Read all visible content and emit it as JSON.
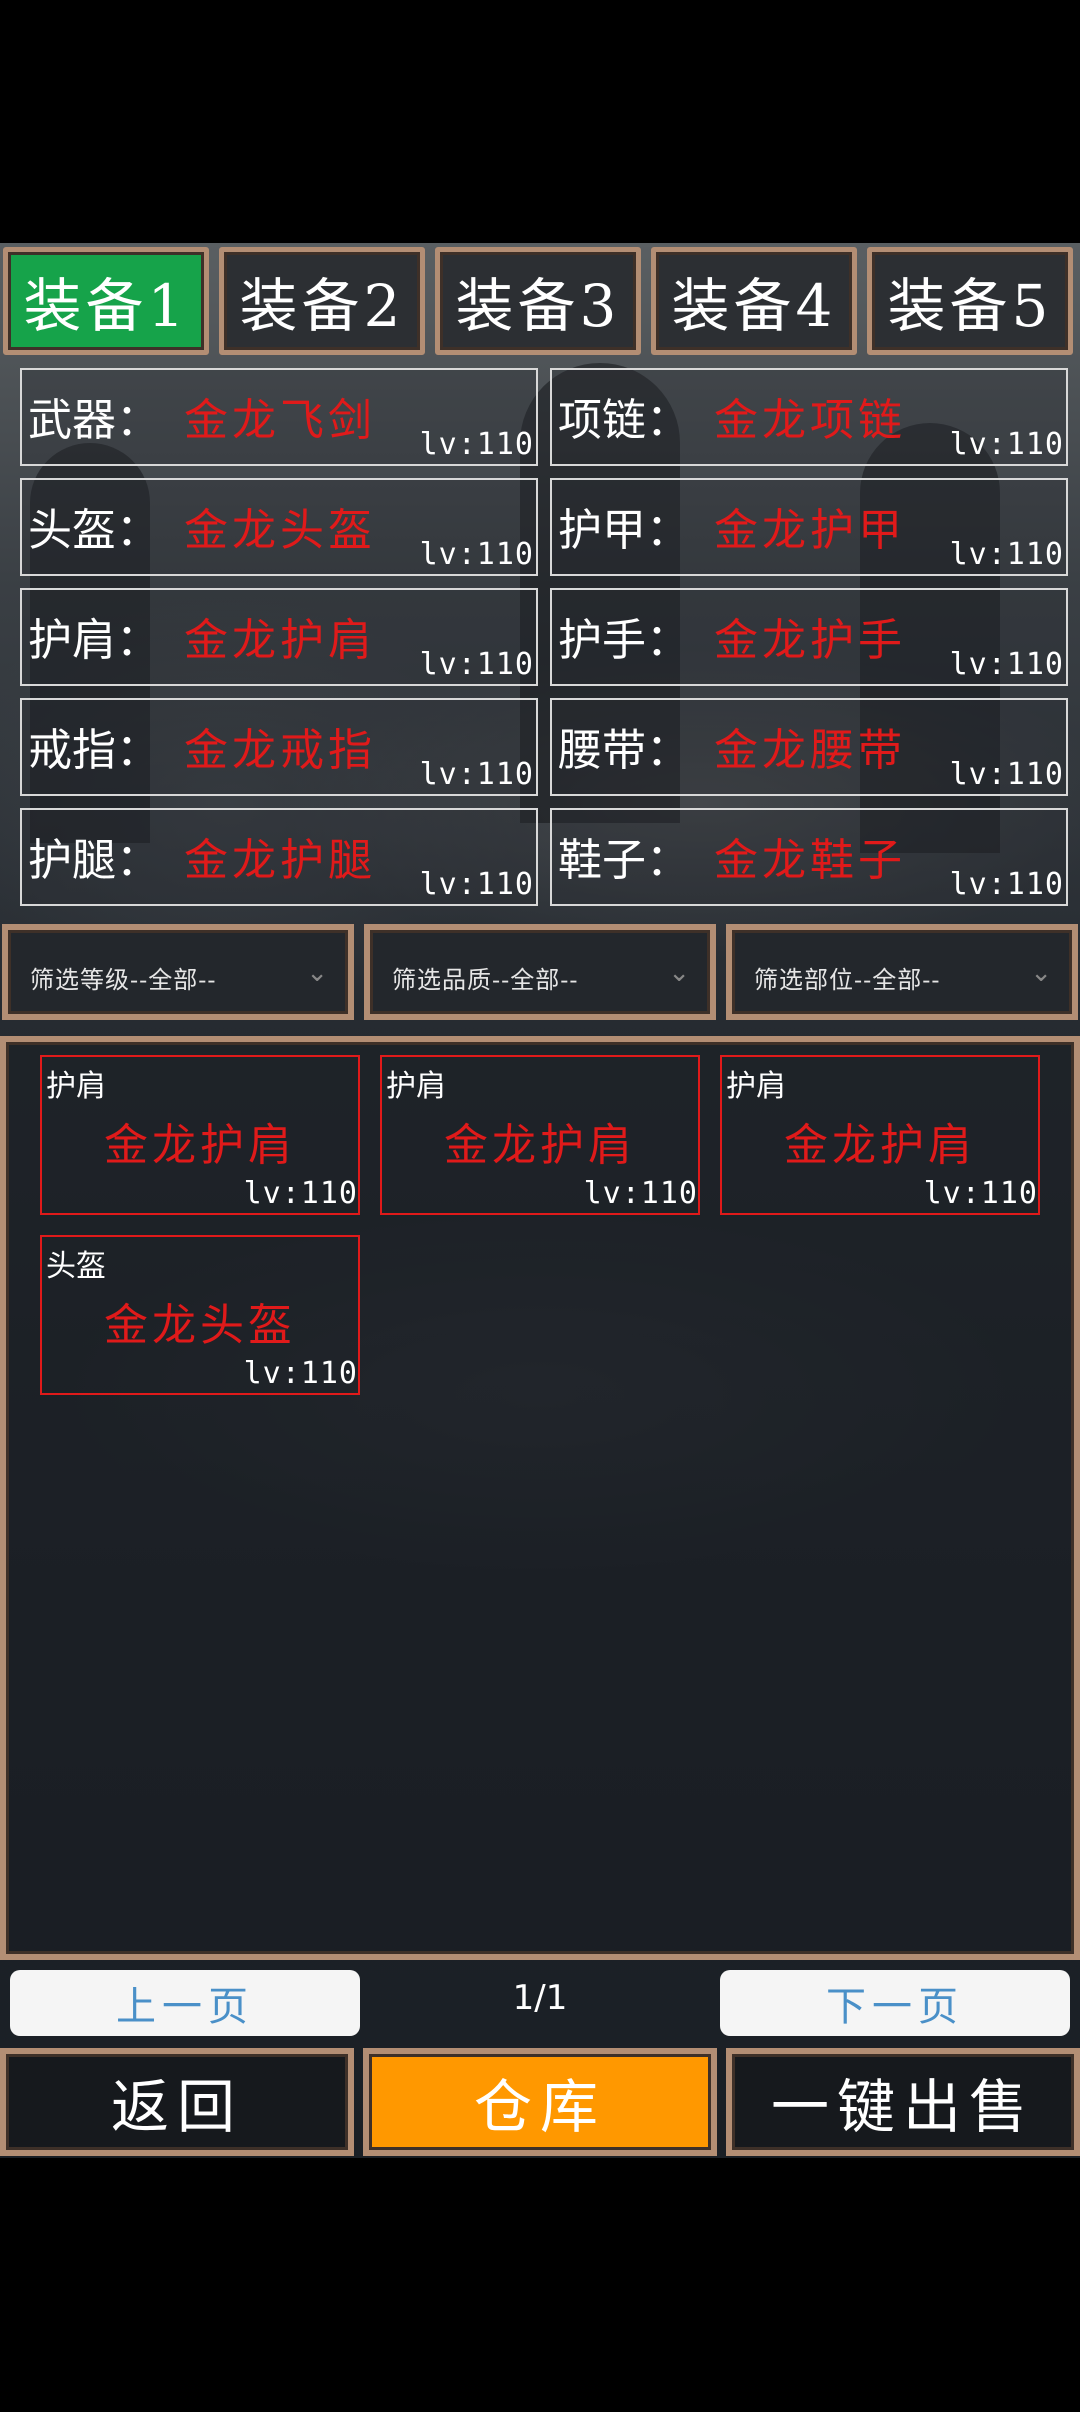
{
  "tabs": [
    "装备1",
    "装备2",
    "装备3",
    "装备4",
    "装备5"
  ],
  "active_tab": 0,
  "slots": [
    {
      "label": "武器：",
      "name": "金龙飞剑",
      "lv": "lv:110"
    },
    {
      "label": "项链：",
      "name": "金龙项链",
      "lv": "lv:110"
    },
    {
      "label": "头盔：",
      "name": "金龙头盔",
      "lv": "lv:110"
    },
    {
      "label": "护甲：",
      "name": "金龙护甲",
      "lv": "lv:110"
    },
    {
      "label": "护肩：",
      "name": "金龙护肩",
      "lv": "lv:110"
    },
    {
      "label": "护手：",
      "name": "金龙护手",
      "lv": "lv:110"
    },
    {
      "label": "戒指：",
      "name": "金龙戒指",
      "lv": "lv:110"
    },
    {
      "label": "腰带：",
      "name": "金龙腰带",
      "lv": "lv:110"
    },
    {
      "label": "护腿：",
      "name": "金龙护腿",
      "lv": "lv:110"
    },
    {
      "label": "鞋子：",
      "name": "金龙鞋子",
      "lv": "lv:110"
    }
  ],
  "filters": [
    "筛选等级--全部--",
    "筛选品质--全部--",
    "筛选部位--全部--"
  ],
  "items": [
    {
      "type": "护肩",
      "name": "金龙护肩",
      "lv": "lv:110"
    },
    {
      "type": "护肩",
      "name": "金龙护肩",
      "lv": "lv:110"
    },
    {
      "type": "护肩",
      "name": "金龙护肩",
      "lv": "lv:110"
    },
    {
      "type": "头盔",
      "name": "金龙头盔",
      "lv": "lv:110"
    }
  ],
  "pager": {
    "prev": "上一页",
    "next": "下一页",
    "indicator": "1/1"
  },
  "buttons": {
    "back": "返回",
    "warehouse": "仓库",
    "sell_all": "一键出售"
  },
  "colors": {
    "active_tab": "#16a34a",
    "item_red": "#e01a1a",
    "frame": "#b38e74",
    "warehouse": "#ff9800",
    "pager_text": "#4a90c8"
  }
}
